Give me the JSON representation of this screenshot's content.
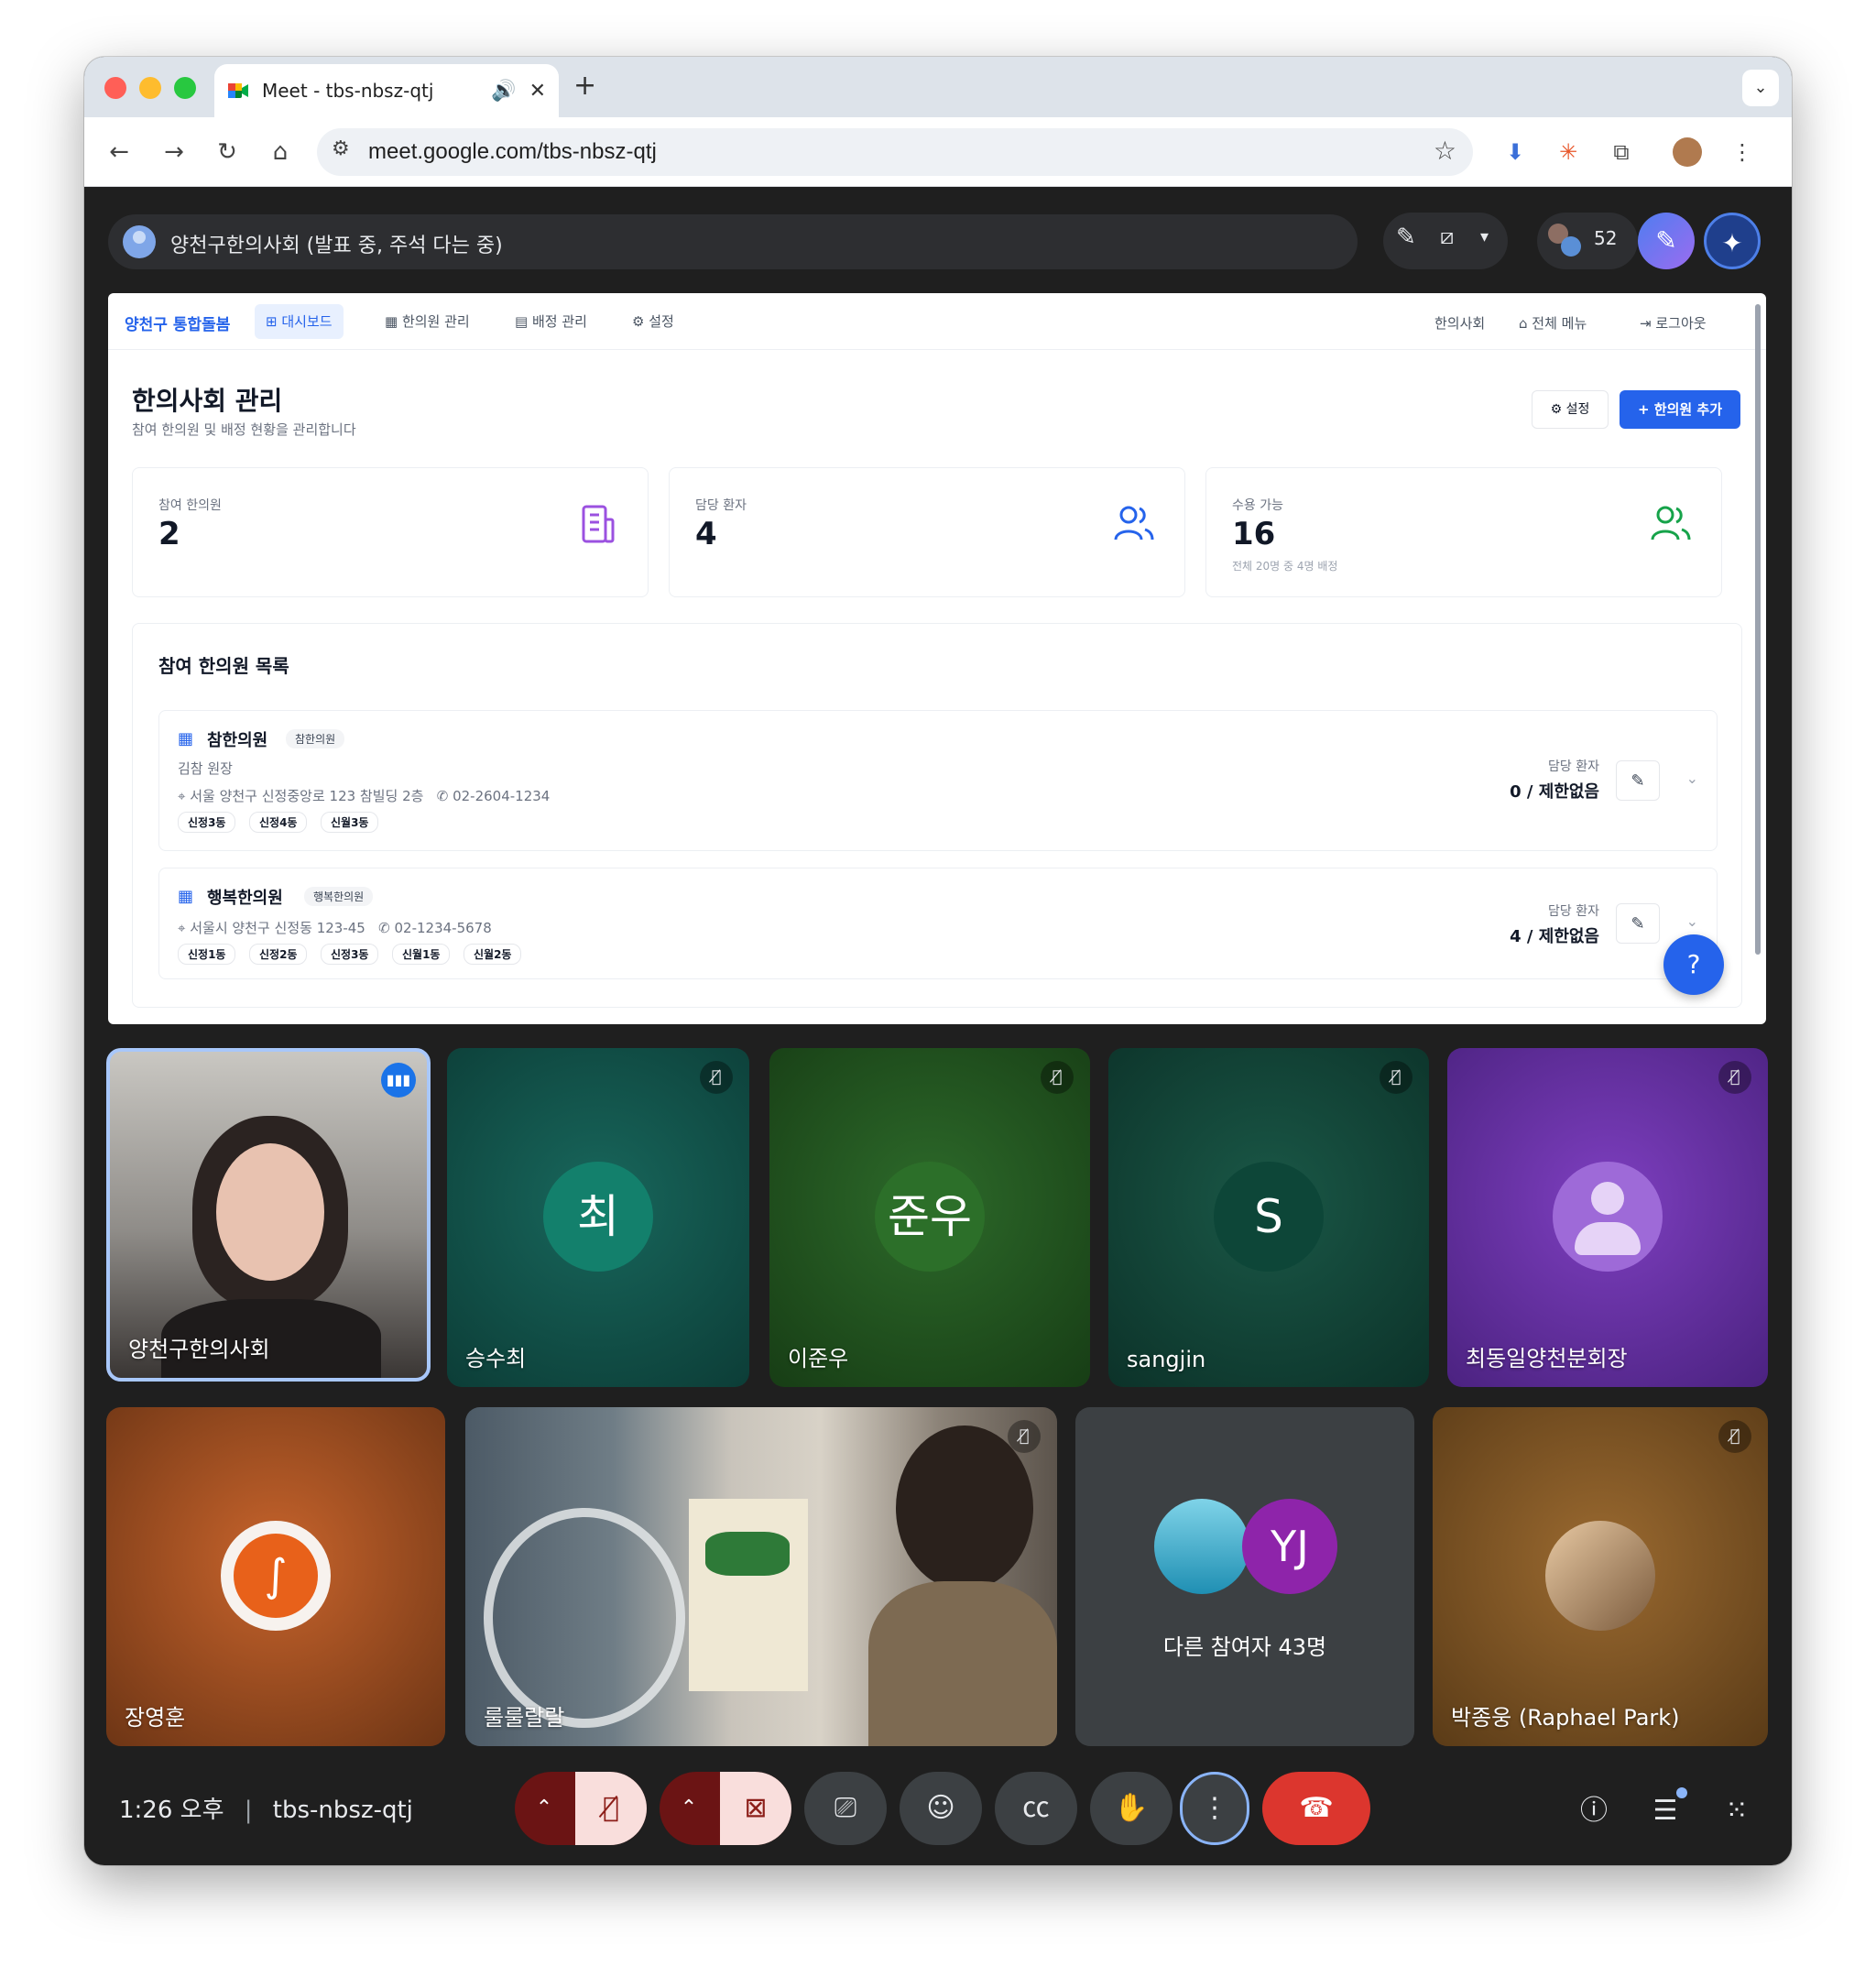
{
  "browser": {
    "tab_title": "Meet - tbs-nbsz-qtj",
    "audio_icon": "speaker-icon",
    "close_glyph": "✕",
    "newtab_glyph": "+",
    "url": "meet.google.com/tbs-nbsz-qtj"
  },
  "meet": {
    "presenter_label": "양천구한의사회 (발표 중, 주석 다는 중)",
    "participant_count": "52",
    "time": "1:26 오후",
    "meeting_code": "tbs-nbsz-qtj"
  },
  "app": {
    "brand": "양천구 통합돌봄",
    "tabs": [
      {
        "label": "대시보드"
      },
      {
        "label": "한의원 관리"
      },
      {
        "label": "배정 관리"
      },
      {
        "label": "설정"
      }
    ],
    "right_links": [
      "한의사회",
      "전체 메뉴",
      "로그아웃"
    ],
    "title": "한의사회 관리",
    "subtitle": "참여 한의원 및 배정 현황을 관리합니다",
    "settings_btn": "설정",
    "add_btn": "+ 한의원 추가",
    "stats": [
      {
        "label": "참여 한의원",
        "value": "2",
        "note": "",
        "color": "#9b51e0"
      },
      {
        "label": "담당 환자",
        "value": "4",
        "note": "",
        "color": "#2563eb"
      },
      {
        "label": "수용 가능",
        "value": "16",
        "note": "전체 20명 중 4명 배정",
        "color": "#16a34a"
      }
    ],
    "list_title": "참여 한의원 목록",
    "clinics": [
      {
        "name": "참한의원",
        "badge": "참한의원",
        "owner": "김참 원장",
        "address": "서울 양천구 신정중앙로 123 참빌딩 2층",
        "phone": "02-2604-1234",
        "tags": [
          "신정3동",
          "신정4동",
          "신월3동"
        ],
        "patients_label": "담당 환자",
        "patients_value": "0 / 제한없음"
      },
      {
        "name": "행복한의원",
        "badge": "행복한의원",
        "owner": "",
        "address": "서울시 양천구 신정동 123-45",
        "phone": "02-1234-5678",
        "tags": [
          "신정1동",
          "신정2동",
          "신정3동",
          "신월1동",
          "신월2동"
        ],
        "patients_label": "담당 환자",
        "patients_value": "4 / 제한없음"
      }
    ]
  },
  "participants": [
    {
      "name": "양천구한의사회",
      "initial": ""
    },
    {
      "name": "승수최",
      "initial": "최"
    },
    {
      "name": "이준우",
      "initial": "준우"
    },
    {
      "name": "sangjin",
      "initial": "S"
    },
    {
      "name": "최동일양천분회장",
      "initial": ""
    },
    {
      "name": "장영훈",
      "initial": ""
    },
    {
      "name": "룰룰랄랄",
      "initial": ""
    },
    {
      "name": "다른 참여자 43명",
      "initial": "YJ"
    },
    {
      "name": "박종웅 (Raphael Park)",
      "initial": ""
    }
  ],
  "colors": {
    "accent": "#2563eb",
    "meet_bg": "#1f1f1f",
    "end_call": "#e53935",
    "speaking_ring": "#a8c7fa"
  }
}
